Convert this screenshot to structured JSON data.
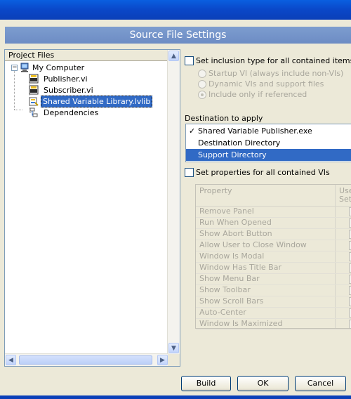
{
  "window": {
    "header": "Source File Settings"
  },
  "tree": {
    "header": "Project Files",
    "items": [
      {
        "label": "My Computer",
        "expander": "−"
      },
      {
        "label": "Publisher.vi"
      },
      {
        "label": "Subscriber.vi"
      },
      {
        "label": "Shared Variable Library.lvlib"
      },
      {
        "label": "Dependencies"
      }
    ]
  },
  "inclusion": {
    "checkbox_label": "Set inclusion type for all contained items",
    "options": [
      "Startup VI (always include non-VIs)",
      "Dynamic VIs and support files",
      "Include only if referenced"
    ],
    "selected_option": "Include only if referenced"
  },
  "destination": {
    "label": "Destination to apply",
    "check_glyph": "✓",
    "items": [
      {
        "name": "Shared Variable Publisher.exe",
        "checked": true
      },
      {
        "name": "Destination Directory",
        "checked": false
      },
      {
        "name": "Support Directory",
        "checked": false,
        "highlighted": true
      }
    ]
  },
  "properties": {
    "checkbox_label": "Set properties for all contained VIs",
    "col_property": "Property",
    "col_user_1": "Use",
    "col_user_2": "Setti",
    "rows": [
      "Remove Panel",
      "Run When Opened",
      "Show Abort Button",
      "Allow User to Close Window",
      "Window Is Modal",
      "Window Has Title Bar",
      "Show Menu Bar",
      "Show Toolbar",
      "Show Scroll Bars",
      "Auto-Center",
      "Window Is Maximized"
    ]
  },
  "buttons": {
    "build": "Build",
    "ok": "OK",
    "cancel": "Cancel"
  },
  "scroll_glyphs": {
    "up": "▲",
    "down": "▼",
    "left": "◀",
    "right": "▶"
  },
  "colors": {
    "accent": "#316ac5",
    "header": "#7d9dcf",
    "titlebar": "#0a47c8"
  }
}
